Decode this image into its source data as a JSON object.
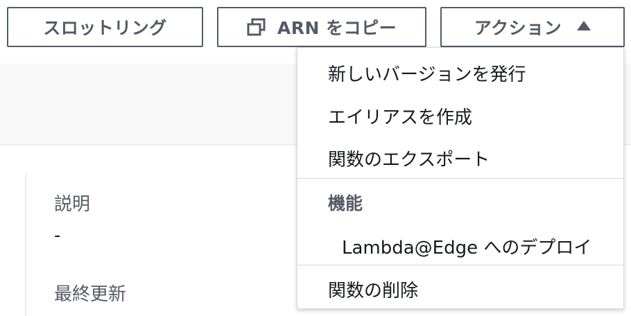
{
  "toolbar": {
    "throttle_label": "スロットリング",
    "copy_arn_label": "ARN をコピー",
    "actions_label": "アクション"
  },
  "details": {
    "description_label": "説明",
    "description_value": "-",
    "last_modified_label": "最終更新"
  },
  "actions_menu": {
    "publish_version": "新しいバージョンを発行",
    "create_alias": "エイリアスを作成",
    "export_function": "関数のエクスポート",
    "capabilities_header": "機能",
    "deploy_lambda_edge": "Lambda@Edge へのデプロイ",
    "delete_function": "関数の削除"
  }
}
